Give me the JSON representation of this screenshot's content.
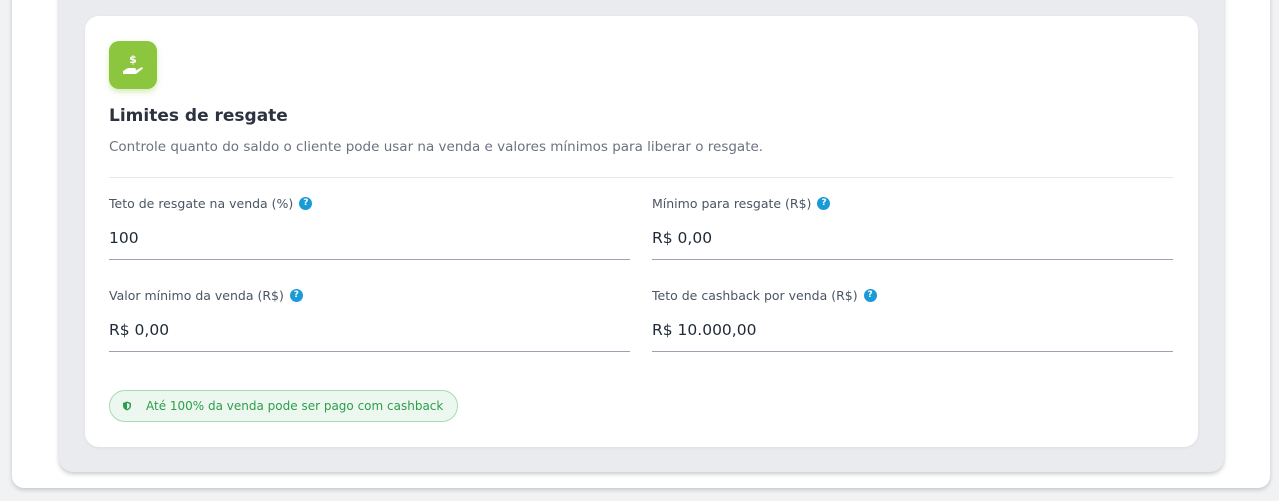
{
  "card": {
    "title": "Limites de resgate",
    "subtitle": "Controle quanto do saldo o cliente pode usar na venda e valores mínimos para liberar o resgate.",
    "icon": "hand-money-icon",
    "accent_color": "#8cc63f"
  },
  "fields": {
    "teto_resgate": {
      "label": "Teto de resgate na venda (%)",
      "value": "100",
      "help": "?"
    },
    "minimo_resgate": {
      "label": "Mínimo para resgate (R$)",
      "value": "R$ 0,00",
      "help": "?"
    },
    "valor_minimo_venda": {
      "label": "Valor mínimo da venda (R$)",
      "value": "R$ 0,00",
      "help": "?"
    },
    "teto_cashback": {
      "label": "Teto de cashback por venda (R$)",
      "value": "R$ 10.000,00",
      "help": "?"
    }
  },
  "badge": {
    "text": "Até 100% da venda pode ser pago com cashback",
    "icon": "shield-icon",
    "color": "#2e9d4c"
  }
}
